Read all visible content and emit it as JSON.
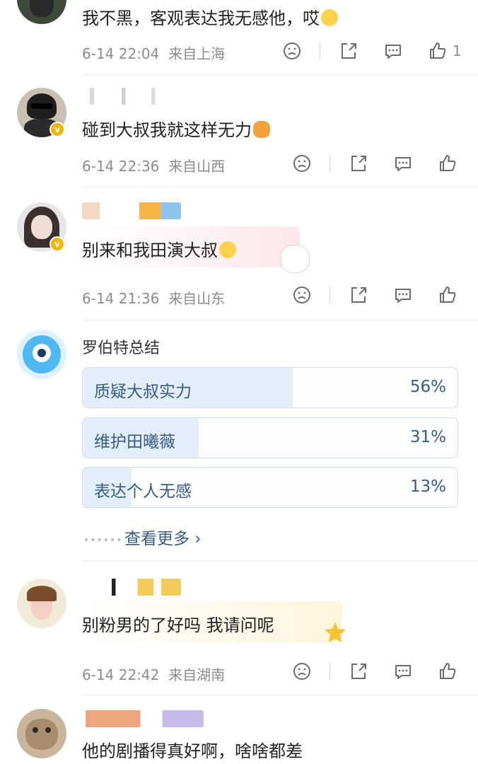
{
  "comments": [
    {
      "content": "我不黑，客观表达我无感他，哎",
      "time": "6-14 22:04",
      "location": "来自上海",
      "like_count": "1"
    },
    {
      "content": "碰到大叔我就这样无力",
      "time": "6-14 22:36",
      "location": "来自山西",
      "like_count": ""
    },
    {
      "content": "别来和我田演大叔",
      "time": "6-14 21:36",
      "location": "来自山东",
      "like_count": ""
    },
    {
      "content": "别粉男的了好吗 我请问呢",
      "time": "6-14 22:42",
      "location": "来自湖南",
      "like_count": ""
    },
    {
      "content": "他的剧播得真好啊，啥啥都差",
      "time": "",
      "location": "",
      "like_count": ""
    }
  ],
  "poll": {
    "title": "罗伯特总结",
    "options": [
      {
        "label": "质疑大叔实力",
        "percent_text": "56%",
        "fraction": 0.56
      },
      {
        "label": "维护田曦薇",
        "percent_text": "31%",
        "fraction": 0.31
      },
      {
        "label": "表达个人无感",
        "percent_text": "13%",
        "fraction": 0.13
      }
    ],
    "more_label": "查看更多 ›"
  },
  "colors": {
    "accent_blue": "#3a5c82",
    "meta_gray": "#8c8c8c",
    "verified_gold": "#f5b400"
  }
}
